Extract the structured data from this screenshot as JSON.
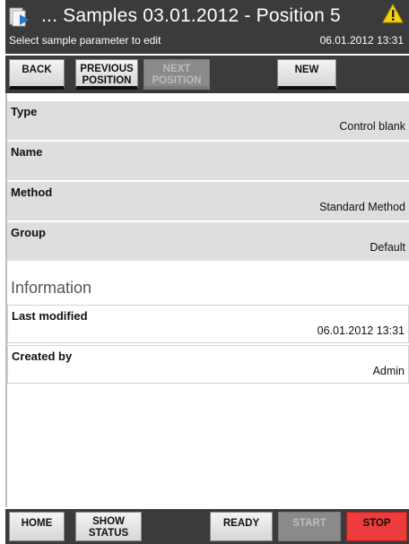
{
  "title": {
    "text": "... Samples 03.01.2012 - Position 5",
    "subtitle": "Select sample parameter to edit",
    "datetime": "06.01.2012 13:31"
  },
  "toolbar": {
    "back": "BACK",
    "previous_line1": "PREVIOUS",
    "previous_line2": "POSITION",
    "next_line1": "NEXT",
    "next_line2": "POSITION",
    "new": "NEW"
  },
  "params": {
    "type_label": "Type",
    "type_value": "Control blank",
    "name_label": "Name",
    "name_value": "",
    "method_label": "Method",
    "method_value": "Standard Method",
    "group_label": "Group",
    "group_value": "Default"
  },
  "information": {
    "heading": "Information",
    "last_modified_label": "Last modified",
    "last_modified_value": "06.01.2012 13:31",
    "created_by_label": "Created by",
    "created_by_value": "Admin"
  },
  "bottombar": {
    "home": "HOME",
    "show_line1": "SHOW",
    "show_line2": "STATUS",
    "ready": "READY",
    "start": "START",
    "stop": "STOP"
  },
  "colors": {
    "bar": "#3b3b3b",
    "row": "#dedede",
    "stop": "#ee3b3b",
    "warning": "#f5d20a"
  },
  "icons": {
    "title": "samples-document-icon",
    "status": "warning-icon"
  }
}
